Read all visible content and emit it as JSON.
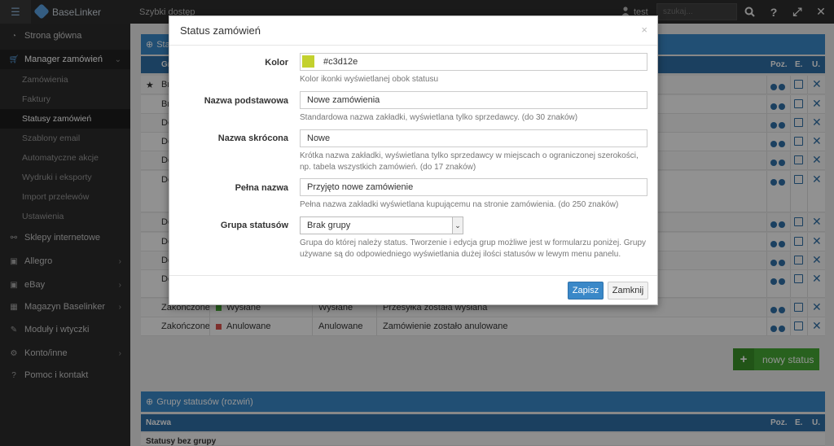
{
  "topbar": {
    "brand": "BaseLinker",
    "quick_access": "Szybki dostęp",
    "user": "test",
    "search_placeholder": "szukaj...",
    "buttons": {
      "search": "⚲",
      "help": "?",
      "fullscreen": "⤢",
      "exit": "✕"
    }
  },
  "sidebar": {
    "items": [
      {
        "label": "Strona główna",
        "icon": "dashboard-icon"
      },
      {
        "label": "Manager zamówień",
        "icon": "cart-icon"
      },
      {
        "label": "Sklepy internetowe",
        "icon": "link-icon"
      },
      {
        "label": "Allegro",
        "icon": "allegro-icon"
      },
      {
        "label": "eBay",
        "icon": "ebay-icon"
      },
      {
        "label": "Magazyn Baselinker",
        "icon": "warehouse-icon"
      },
      {
        "label": "Moduły i wtyczki",
        "icon": "wrench-icon"
      },
      {
        "label": "Konto/inne",
        "icon": "cog-icon"
      },
      {
        "label": "Pomoc i kontakt",
        "icon": "help-icon"
      }
    ],
    "subitems": [
      "Zamówienia",
      "Faktury",
      "Statusy zamówień",
      "Szablony email",
      "Automatyczne akcje",
      "Wydruki i eksporty",
      "Import przelewów",
      "Ustawienia"
    ]
  },
  "main": {
    "panel_title": "Sta",
    "col_group": "Gr",
    "col_pos": "Poz.",
    "col_edit": "E.",
    "col_del": "U.",
    "rows": [
      {
        "group": "Br",
        "color": "",
        "name": "",
        "short": "",
        "full": ""
      },
      {
        "group": "Br",
        "color": "",
        "name": "",
        "short": "",
        "full": ""
      },
      {
        "group": "Do",
        "color": "",
        "name": "",
        "short": "",
        "full": ""
      },
      {
        "group": "Do",
        "color": "",
        "name": "",
        "short": "",
        "full": ""
      },
      {
        "group": "Do",
        "color": "",
        "name": "",
        "short": "",
        "full": ""
      },
      {
        "group": "Do",
        "color": "",
        "name": "",
        "short": "",
        "full": ""
      },
      {
        "group": "Do",
        "color": "",
        "name": "",
        "short": "",
        "full": ""
      },
      {
        "group": "Do",
        "color": "",
        "name": "",
        "short": "",
        "full": ""
      },
      {
        "group": "Do",
        "color": "",
        "name": "",
        "short": "",
        "full": ""
      },
      {
        "group": "Do",
        "color": "",
        "name": "",
        "short": "",
        "full": ""
      },
      {
        "group": "Zakończone",
        "color": "#45a834",
        "name": "Wysłane",
        "short": "Wysłane",
        "full": "Przesyłka została wysłana"
      },
      {
        "group": "Zakończone",
        "color": "#d9534f",
        "name": "Anulowane",
        "short": "Anulowane",
        "full": "Zamówienie zostało anulowane"
      }
    ],
    "new_status_label": "nowy status",
    "groups_panel_title": "Grupy statusów (rozwiń)",
    "groups_col_name": "Nazwa",
    "groups_first_row": "Statusy bez grupy"
  },
  "modal": {
    "title": "Status zamówień",
    "close": "×",
    "fields": {
      "color": {
        "label": "Kolor",
        "value": "#c3d12e",
        "help": "Kolor ikonki wyświetlanej obok statusu"
      },
      "base_name": {
        "label": "Nazwa podstawowa",
        "value": "Nowe zamówienia",
        "help": "Standardowa nazwa zakładki, wyświetlana tylko sprzedawcy. (do 30 znaków)"
      },
      "short_name": {
        "label": "Nazwa skrócona",
        "value": "Nowe",
        "help": "Krótka nazwa zakładki, wyświetlana tylko sprzedawcy w miejscach o ograniczonej szerokości, np. tabela wszystkich zamówień. (do 17 znaków)"
      },
      "full_name": {
        "label": "Pełna nazwa",
        "value": "Przyjęto nowe zamówienie",
        "help": "Pełna nazwa zakładki wyświetlana kupującemu na stronie zamówienia. (do 250 znaków)"
      },
      "group": {
        "label": "Grupa statusów",
        "value": "Brak grupy",
        "help": "Grupa do której należy status. Tworzenie i edycja grup możliwe jest w formularzu poniżej. Grupy używane są do odpowiedniego wyświetlania dużej ilości statusów w lewym menu panelu."
      }
    },
    "save_label": "Zapisz",
    "close_label": "Zamknij"
  }
}
